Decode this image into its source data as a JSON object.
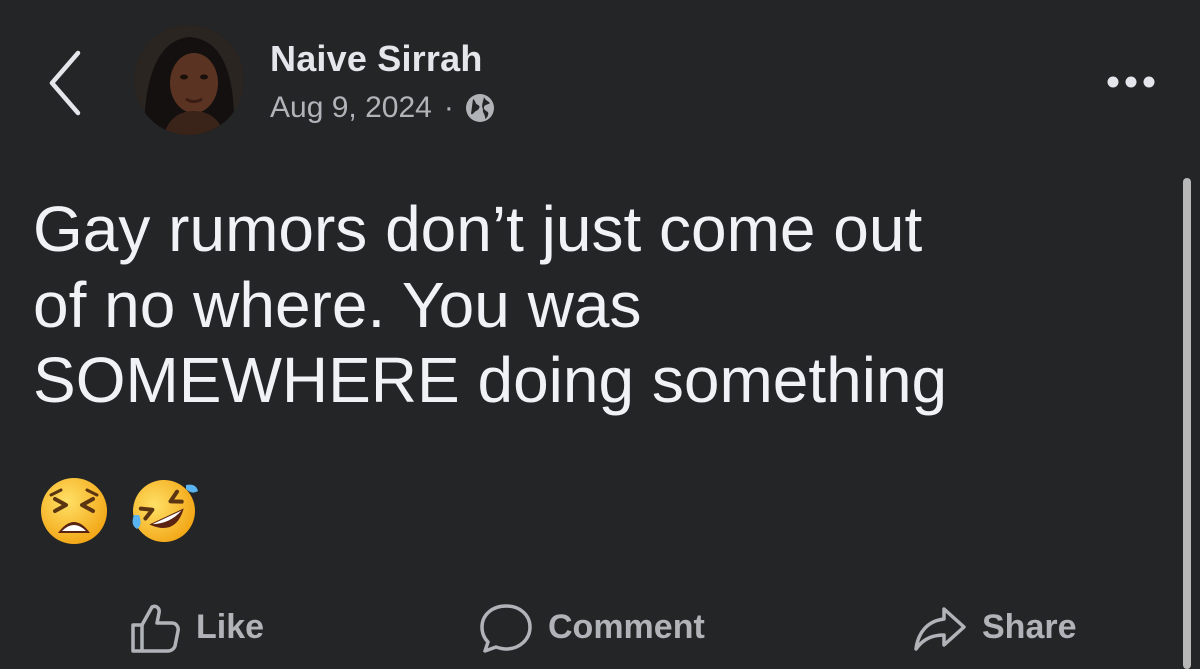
{
  "post": {
    "author": "Naive Sirrah",
    "date": "Aug 9, 2024",
    "separator": "·",
    "line1": "Gay rumors don’t just come out",
    "line2": "of no where. You was",
    "line3": "SOMEWHERE doing something",
    "emojis": [
      "tired-face-emoji",
      "rolling-on-floor-laughing-emoji"
    ]
  },
  "actions": {
    "like": "Like",
    "comment": "Comment",
    "share": "Share"
  },
  "icons": {
    "back": "chevron-left-icon",
    "more": "more-horizontal-icon",
    "privacy": "globe-icon"
  },
  "colors": {
    "background": "#242526",
    "text": "#f0f2f5",
    "secondary": "#b0b3b8"
  }
}
